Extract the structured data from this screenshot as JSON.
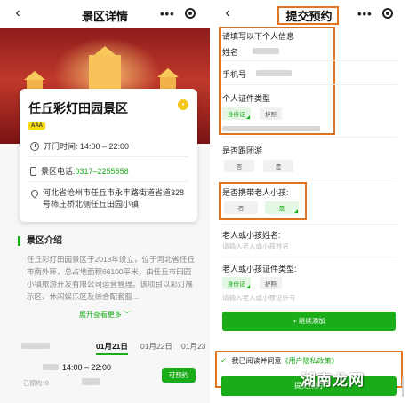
{
  "left": {
    "nav_title": "景区详情",
    "more_icon": "•••",
    "card": {
      "title": "任丘彩灯田园景区",
      "level_badge": "AAA",
      "open_time": "开门时间: 14:00 – 22:00",
      "tel_label": "景区电话: ",
      "tel_value": "0317–2255558",
      "address": "河北省沧州市任丘市永丰路街道省道328号柿庄桥北侧任丘田园小镇"
    },
    "intro": {
      "heading": "景区介绍",
      "text": "任丘彩灯田园景区于2018年设立，位于河北省任丘市南外环，总占地面积66100平米，由任丘市田园小镇旅游开发有限公司运营管理。该项目以彩灯展示区、休闲娱乐区及综合配套服...",
      "expand": "展开查看更多 ﹀"
    },
    "dates": [
      "01月21日",
      "01月22日",
      "01月23"
    ],
    "active_date_index": 0,
    "slot_time": "14:00 – 22:00",
    "booked_text": "已预约: 0",
    "reserve_button": "可预约"
  },
  "right": {
    "nav_title": "提交预约",
    "more_icon": "•••",
    "fill_info_label": "请填写以下个人信息",
    "name_label": "姓名",
    "phone_label": "手机号",
    "id_type_label": "个人证件类型",
    "id_types": [
      "身份证",
      "护照"
    ],
    "group_label": "是否跟团游",
    "group_options": [
      "否",
      "是"
    ],
    "elder_label": "是否携带老人小孩:",
    "elder_options": [
      "否",
      "是"
    ],
    "companion_name_label": "老人或小孩姓名:",
    "companion_name_placeholder": "请输入老人或小孩姓名",
    "companion_id_label": "老人或小孩证件类型:",
    "companion_id_types": [
      "身份证",
      "护照"
    ],
    "companion_id_placeholder": "请输入老人或小孩证件号",
    "add_button": "+ 继续添加",
    "agree_prefix": "我已阅读并同意",
    "agree_link": "《用户隐私政策》",
    "submit_button": "提交预约"
  },
  "watermark": "湖南龙网",
  "colors": {
    "accent": "#1aad19",
    "highlight": "#e2741f"
  }
}
